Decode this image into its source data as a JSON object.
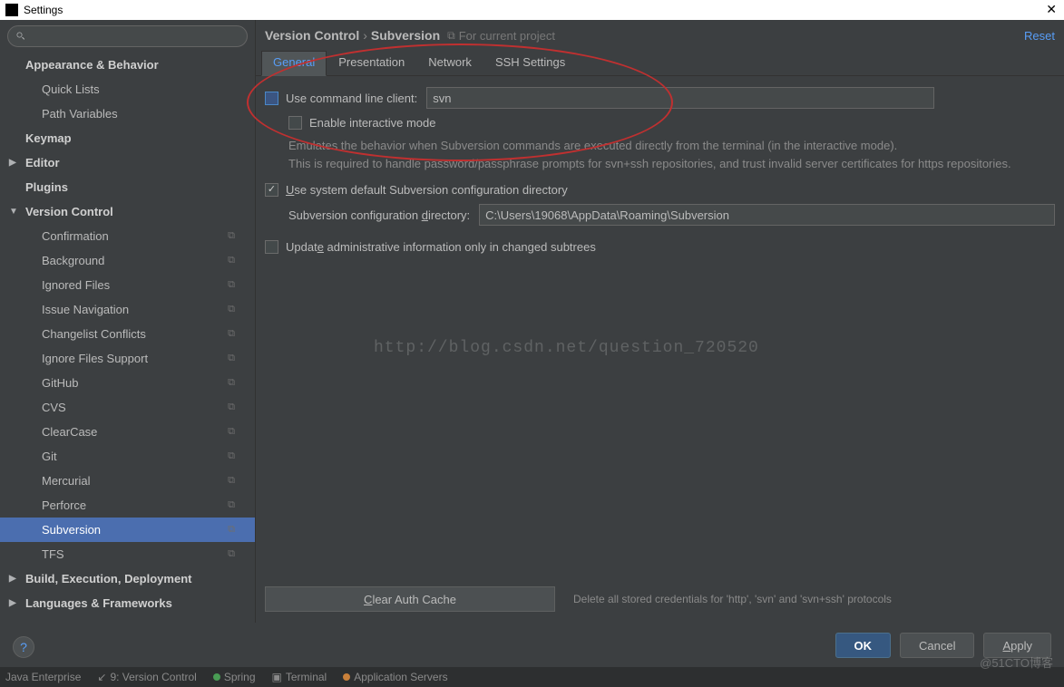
{
  "window": {
    "title": "Settings"
  },
  "search": {
    "placeholder": ""
  },
  "sidebar": {
    "items": [
      {
        "label": "Appearance & Behavior",
        "bold": true
      },
      {
        "label": "Quick Lists",
        "level": 1
      },
      {
        "label": "Path Variables",
        "level": 1
      },
      {
        "label": "Keymap",
        "bold": true
      },
      {
        "label": "Editor",
        "bold": true,
        "arrow": "▶"
      },
      {
        "label": "Plugins",
        "bold": true
      },
      {
        "label": "Version Control",
        "bold": true,
        "arrow": "▼"
      },
      {
        "label": "Confirmation",
        "level": 1,
        "icon": true
      },
      {
        "label": "Background",
        "level": 1,
        "icon": true
      },
      {
        "label": "Ignored Files",
        "level": 1,
        "icon": true
      },
      {
        "label": "Issue Navigation",
        "level": 1,
        "icon": true
      },
      {
        "label": "Changelist Conflicts",
        "level": 1,
        "icon": true
      },
      {
        "label": "Ignore Files Support",
        "level": 1,
        "icon": true
      },
      {
        "label": "GitHub",
        "level": 1,
        "icon": true
      },
      {
        "label": "CVS",
        "level": 1,
        "icon": true
      },
      {
        "label": "ClearCase",
        "level": 1,
        "icon": true
      },
      {
        "label": "Git",
        "level": 1,
        "icon": true
      },
      {
        "label": "Mercurial",
        "level": 1,
        "icon": true
      },
      {
        "label": "Perforce",
        "level": 1,
        "icon": true
      },
      {
        "label": "Subversion",
        "level": 1,
        "icon": true,
        "selected": true
      },
      {
        "label": "TFS",
        "level": 1,
        "icon": true
      },
      {
        "label": "Build, Execution, Deployment",
        "bold": true,
        "arrow": "▶"
      },
      {
        "label": "Languages & Frameworks",
        "bold": true,
        "arrow": "▶"
      }
    ]
  },
  "breadcrumb": {
    "root": "Version Control",
    "leaf": "Subversion",
    "scope": "For current project",
    "reset": "Reset"
  },
  "tabs": [
    "General",
    "Presentation",
    "Network",
    "SSH Settings"
  ],
  "form": {
    "use_cli_label": "Use command line client:",
    "use_cli_value": "svn",
    "enable_interactive": "Enable interactive mode",
    "desc1": "Emulates the behavior when Subversion commands are executed directly from the terminal (in the interactive mode).",
    "desc2": "This is required to handle password/passphrase prompts for svn+ssh repositories, and trust invalid server certificates for https repositories.",
    "use_default_label_pre": "U",
    "use_default_label": "se system default Subversion configuration directory",
    "config_dir_label_pre": "Subversion configuration ",
    "config_dir_label_u": "d",
    "config_dir_label_post": "irectory:",
    "config_dir_value": "C:\\Users\\19068\\AppData\\Roaming\\Subversion",
    "update_admin_label_pre": "Updat",
    "update_admin_label_u": "e",
    "update_admin_label_post": " administrative information only in changed subtrees",
    "clear_cache_pre": "C",
    "clear_cache_post": "lear Auth Cache",
    "clear_cache_desc": "Delete all stored credentials for 'http', 'svn' and 'svn+ssh' protocols"
  },
  "watermark": "http://blog.csdn.net/question_720520",
  "buttons": {
    "ok": "OK",
    "cancel": "Cancel",
    "apply_u": "A",
    "apply_post": "pply"
  },
  "statusbar": {
    "java": "Java Enterprise",
    "vc": "9: Version Control",
    "spring": "Spring",
    "terminal": "Terminal",
    "appservers": "Application Servers"
  },
  "cto": "@51CTO博客"
}
